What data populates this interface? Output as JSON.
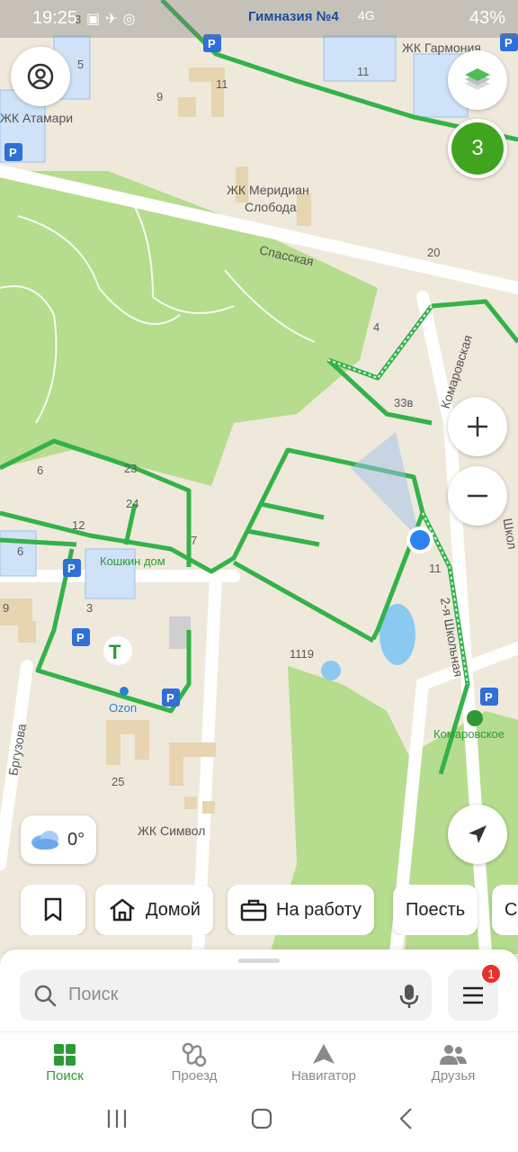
{
  "status_bar": {
    "time": "19:25",
    "poi": "Гимназия №4",
    "network": "4G",
    "battery": "43%"
  },
  "map": {
    "labels": {
      "atamari": "ЖК Атамари",
      "garmonia": "ЖК Гармония",
      "meridian1": "ЖК Меридиан",
      "meridian2": "Слобода",
      "spasskaya": "Спасская",
      "komarovskaya": "Комаровская",
      "koshkin": "Кошкин дом",
      "ozon": "Ozon",
      "simvol": "ЖК Символ",
      "shkolnaya": "2-я Школьная",
      "komarovskoe": "Комаровское",
      "burgova": "Бргузова",
      "shko": "Школ",
      "n5": "5",
      "n9": "9",
      "n11a": "11",
      "n11b": "11",
      "n11c": "11",
      "n20": "20",
      "n4": "4",
      "n33v": "33в",
      "n6a": "6",
      "n6b": "6",
      "n23": "23",
      "n24": "24",
      "n12": "12",
      "n7": "7",
      "n3": "3",
      "n9b": "9",
      "n1119": "1119",
      "n25": "25",
      "n3top": "3"
    },
    "traffic_level": "3",
    "colors": {
      "park": "#b6dc8e",
      "road": "#ffffff",
      "bike": "#34b24a",
      "water": "#8cc9f0",
      "traffic": "#3fa51f"
    }
  },
  "weather": {
    "temperature": "0°"
  },
  "chips": {
    "home": "Домой",
    "work": "На работу",
    "eat": "Поесть",
    "more": "С"
  },
  "search": {
    "placeholder": "Поиск",
    "menu_badge": "1"
  },
  "tabs": {
    "search": "Поиск",
    "route": "Проезд",
    "navigator": "Навигатор",
    "friends": "Друзья"
  }
}
